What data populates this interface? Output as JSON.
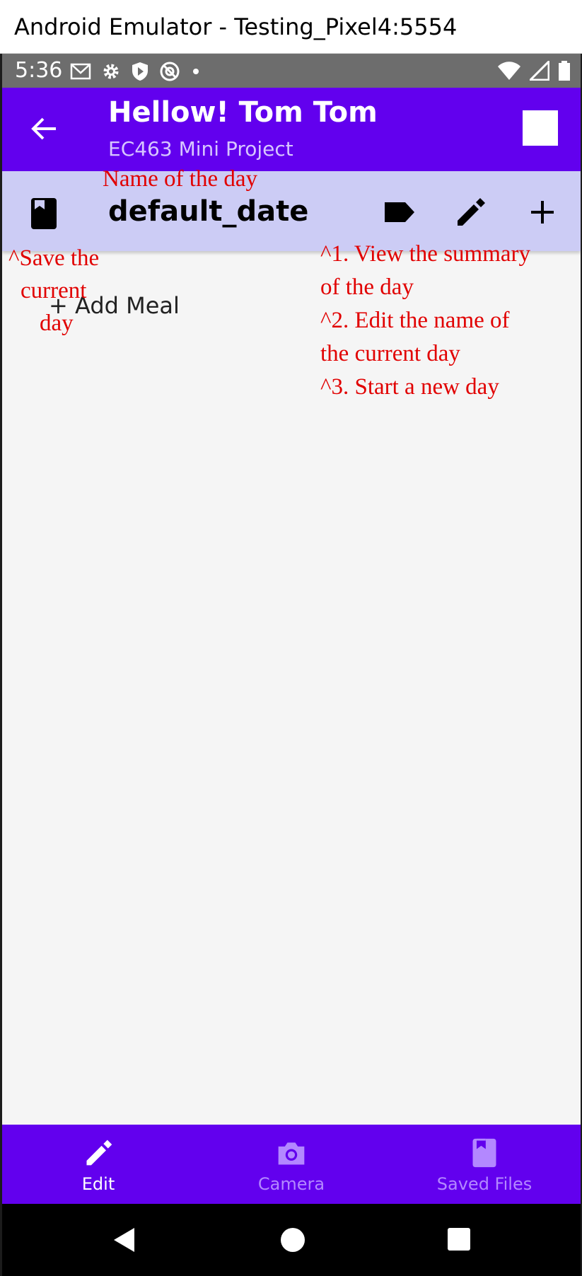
{
  "window": {
    "title": "Android Emulator - Testing_Pixel4:5554"
  },
  "status_bar": {
    "time": "5:36",
    "icons": [
      "gmail-icon",
      "settings-icon",
      "shield-icon",
      "at-sign-icon",
      "dot-icon"
    ],
    "right_icons": [
      "wifi-icon",
      "signal-icon",
      "battery-icon"
    ]
  },
  "app_bar": {
    "title": "Hellow! Tom Tom",
    "subtitle": "EC463 Mini Project",
    "back_icon": "back-arrow-icon",
    "action_icon": "stop-square-icon"
  },
  "day_bar": {
    "day_name": "default_date",
    "icons": [
      "bookmark-icon",
      "label-icon",
      "edit-pencil-icon",
      "plus-icon"
    ]
  },
  "main": {
    "add_meal_label": "+ Add Meal"
  },
  "annotations": {
    "name_of_day": "Name of the day",
    "save_line1": "^Save the",
    "save_line2": "current",
    "save_line3": "day",
    "actions_line1": "^1. View the summary",
    "actions_line2": "of the day",
    "actions_line3": "^2. Edit the name of",
    "actions_line4": "the current day",
    "actions_line5": "^3. Start a new day"
  },
  "bottom_nav": {
    "items": [
      {
        "label": "Edit",
        "icon": "edit-pencil-icon",
        "active": true
      },
      {
        "label": "Camera",
        "icon": "camera-icon",
        "active": false
      },
      {
        "label": "Saved Files",
        "icon": "bookmark-icon",
        "active": false
      }
    ]
  },
  "system_nav": {
    "icons": [
      "back-triangle-icon",
      "home-circle-icon",
      "overview-square-icon"
    ]
  },
  "colors": {
    "primary": "#6200ee",
    "day_bar": "#ccccf5",
    "annotation": "#e10000",
    "inactive_nav": "#b388ff"
  }
}
